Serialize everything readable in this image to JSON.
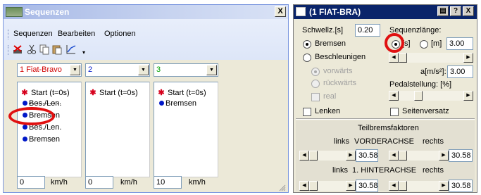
{
  "left_window": {
    "title": "Sequenzen",
    "close": "X",
    "menu": [
      "Sequenzen",
      "Bearbeiten",
      "Optionen"
    ],
    "toolbar_icons": [
      "delete-icon",
      "cut-icon",
      "copy-icon",
      "paste-icon",
      "chart-icon",
      "dropdown-icon"
    ],
    "columns": [
      {
        "select": "1  Fiat-Bravo",
        "select_color": "#d00000",
        "items": [
          {
            "mark": "star",
            "text": "Start (t=0s)"
          },
          {
            "mark": "dot",
            "text": "Bes./Len."
          },
          {
            "mark": "dot",
            "text": "Bremsen"
          },
          {
            "mark": "dot",
            "text": "Bes./Len."
          },
          {
            "mark": "dot",
            "text": "Bremsen"
          }
        ],
        "speed": "0",
        "unit": "km/h"
      },
      {
        "select": "2",
        "select_color": "#0018c8",
        "items": [
          {
            "mark": "star",
            "text": "Start (t=0s)"
          }
        ],
        "speed": "0",
        "unit": "km/h"
      },
      {
        "select": "3",
        "select_color": "#00a000",
        "items": [
          {
            "mark": "star",
            "text": "Start (t=0s)"
          },
          {
            "mark": "dot",
            "text": "Bremsen"
          }
        ],
        "speed": "10",
        "unit": "km/h"
      }
    ]
  },
  "right_window": {
    "title": "(1  FIAT-BRA)",
    "buttons": [
      "▤",
      "?",
      "X"
    ],
    "schwellz_label": "Schwellz.[s]",
    "schwellz_value": "0.20",
    "seqlen_label": "Sequenzlänge:",
    "unit_s": "[s]",
    "unit_m": "[m]",
    "seqlen_value": "3.00",
    "mode_bremsen": "Bremsen",
    "mode_beschleunigen": "Beschleunigen",
    "dir_vorwaerts": "vorwärts",
    "dir_rueckwaerts": "rückwärts",
    "real": "real",
    "accel_label": "a[m/s²]:",
    "accel_value": "3.00",
    "pedal_label": "Pedalstellung: [%]",
    "lenken": "Lenken",
    "seitenversatz": "Seitenversatz",
    "teilbrems_title": "Teilbremsfaktoren",
    "links": "links",
    "rechts": "rechts",
    "vorderachse": "VORDERACHSE",
    "hinterachse": "1. HINTERACHSE",
    "va_links": "30.58",
    "va_rechts": "30.58",
    "ha_links": "30.58",
    "ha_rechts": "30.58"
  },
  "colors": {
    "highlight_ellipse": "#e01010",
    "star": "#d6001c",
    "dot": "#0018c8"
  }
}
